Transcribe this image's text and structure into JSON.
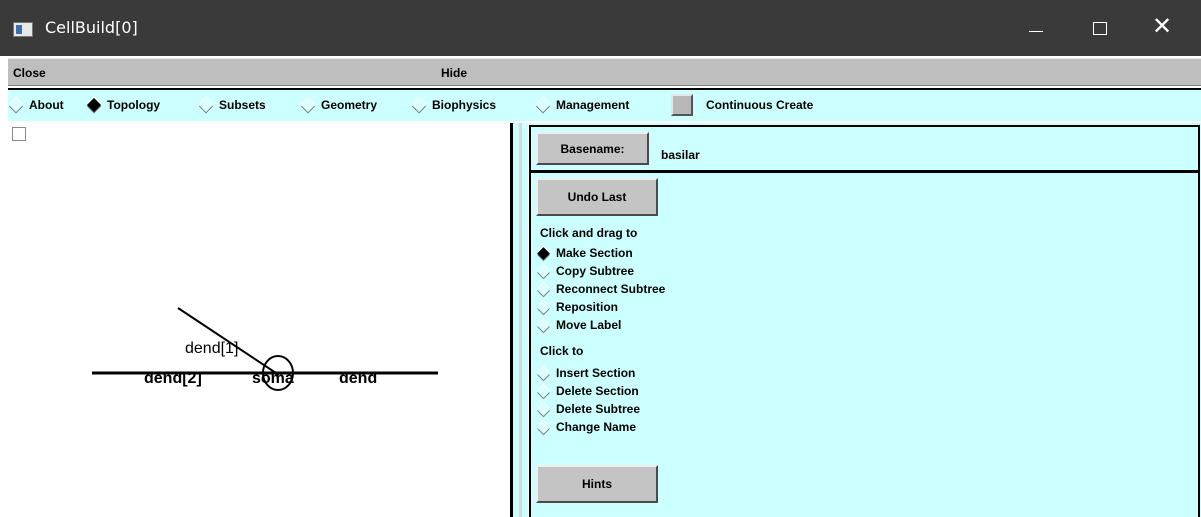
{
  "window": {
    "title": "CellBuild[0]"
  },
  "menubar": {
    "close_label": "Close",
    "hide_label": "Hide"
  },
  "tabs": [
    {
      "label": "About",
      "selected": false
    },
    {
      "label": "Topology",
      "selected": true
    },
    {
      "label": "Subsets",
      "selected": false
    },
    {
      "label": "Geometry",
      "selected": false
    },
    {
      "label": "Biophysics",
      "selected": false
    },
    {
      "label": "Management",
      "selected": false
    }
  ],
  "continuous_create": {
    "label": "Continuous Create",
    "checked": false
  },
  "canvas": {
    "section_labels": {
      "dend1": "dend[1]",
      "dend2": "dend[2]",
      "soma": "soma",
      "dend": "dend"
    }
  },
  "panel": {
    "basename_button": "Basename:",
    "basename_value": "basilar",
    "undo_button": "Undo Last",
    "drag_heading": "Click and drag to",
    "drag_options": [
      {
        "label": "Make Section",
        "selected": true
      },
      {
        "label": "Copy Subtree",
        "selected": false
      },
      {
        "label": "Reconnect Subtree",
        "selected": false
      },
      {
        "label": "Reposition",
        "selected": false
      },
      {
        "label": "Move Label",
        "selected": false
      }
    ],
    "click_heading": "Click to",
    "click_options": [
      {
        "label": "Insert Section",
        "selected": false
      },
      {
        "label": "Delete Section",
        "selected": false
      },
      {
        "label": "Delete Subtree",
        "selected": false
      },
      {
        "label": "Change Name",
        "selected": false
      }
    ],
    "hints_button": "Hints"
  },
  "colors": {
    "panel_bg": "#ccffff",
    "titlebar_bg": "#3a3a3a",
    "menubar_bg": "#bebebe"
  }
}
